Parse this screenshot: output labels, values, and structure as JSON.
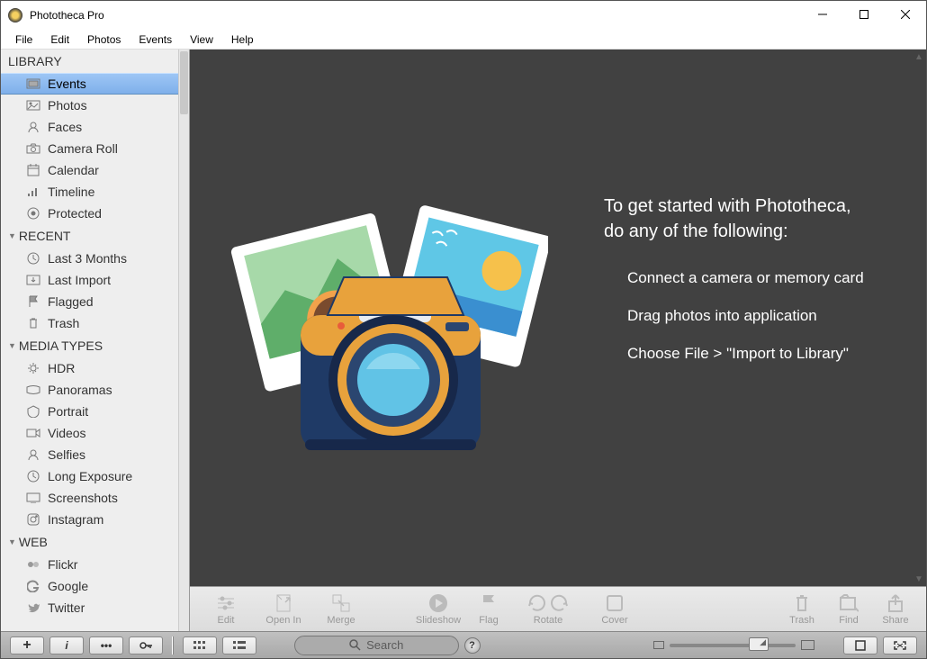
{
  "title": "Phototheca Pro",
  "menu": {
    "file": "File",
    "edit": "Edit",
    "photos": "Photos",
    "events": "Events",
    "view": "View",
    "help": "Help"
  },
  "sidebar": {
    "library": {
      "header": "LIBRARY",
      "items": [
        {
          "label": "Events",
          "icon": "events"
        },
        {
          "label": "Photos",
          "icon": "photos"
        },
        {
          "label": "Faces",
          "icon": "faces"
        },
        {
          "label": "Camera Roll",
          "icon": "camera"
        },
        {
          "label": "Calendar",
          "icon": "calendar"
        },
        {
          "label": "Timeline",
          "icon": "timeline"
        },
        {
          "label": "Protected",
          "icon": "protected"
        }
      ]
    },
    "recent": {
      "header": "RECENT",
      "items": [
        {
          "label": "Last 3 Months",
          "icon": "clock"
        },
        {
          "label": "Last Import",
          "icon": "import"
        },
        {
          "label": "Flagged",
          "icon": "flag"
        },
        {
          "label": "Trash",
          "icon": "trash"
        }
      ]
    },
    "media": {
      "header": "MEDIA TYPES",
      "items": [
        {
          "label": "HDR",
          "icon": "hdr"
        },
        {
          "label": "Panoramas",
          "icon": "pano"
        },
        {
          "label": "Portrait",
          "icon": "portrait"
        },
        {
          "label": "Videos",
          "icon": "video"
        },
        {
          "label": "Selfies",
          "icon": "selfie"
        },
        {
          "label": "Long Exposure",
          "icon": "long"
        },
        {
          "label": "Screenshots",
          "icon": "screen"
        },
        {
          "label": "Instagram",
          "icon": "insta"
        }
      ]
    },
    "web": {
      "header": "WEB",
      "items": [
        {
          "label": "Flickr",
          "icon": "flickr"
        },
        {
          "label": "Google",
          "icon": "google"
        },
        {
          "label": "Twitter",
          "icon": "twitter"
        }
      ]
    }
  },
  "welcome": {
    "line1": "To get started with Phototheca,",
    "line2": "do any of the following:",
    "opt1": "Connect a camera or memory card",
    "opt2": "Drag photos into application",
    "opt3": "Choose File > \"Import to Library\""
  },
  "toolbar": {
    "edit": "Edit",
    "openin": "Open In",
    "merge": "Merge",
    "slideshow": "Slideshow",
    "flag": "Flag",
    "rotate": "Rotate",
    "cover": "Cover",
    "trash": "Trash",
    "find": "Find",
    "share": "Share"
  },
  "bottom": {
    "search": "Search"
  }
}
